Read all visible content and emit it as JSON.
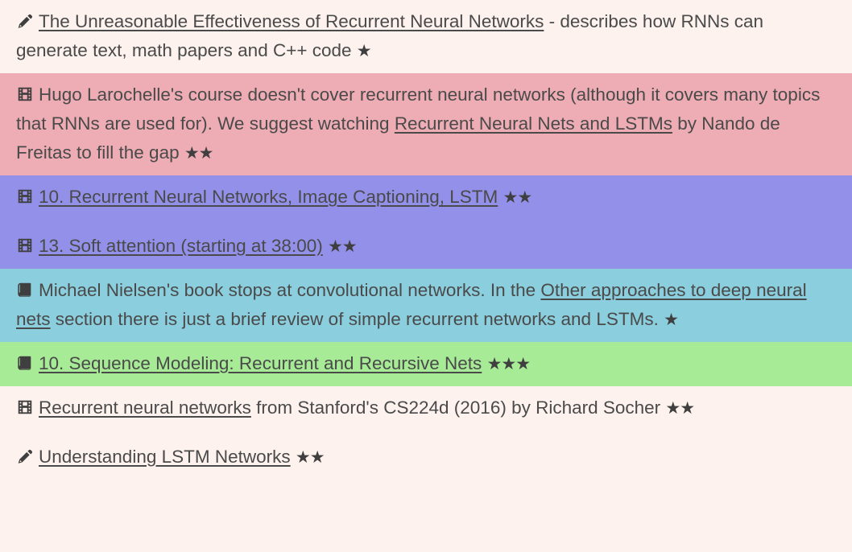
{
  "page": {
    "background_color": "#fdf2ee",
    "text_color": "#4a4a4a"
  },
  "icons": {
    "pencil": "pencil-icon",
    "film": "film-icon",
    "book": "book-icon"
  },
  "entries": [
    {
      "id": "rnn-effectiveness",
      "icon": "pencil-icon",
      "highlight": "none",
      "highlight_color": "#fdf2ee",
      "link_text": "The Unreasonable Effectiveness of Recurrent Neural Networks",
      "after_text": " - describes how RNNs can generate text, math papers and C++ code ",
      "stars": "★",
      "star_count": 1
    },
    {
      "id": "hugo-larochelle-gap",
      "icon": "film-icon",
      "highlight": "pink",
      "highlight_color": "#eeacb4",
      "before_text": "Hugo Larochelle's course doesn't cover recurrent neural networks (although it covers many topics that RNNs are used for). We suggest watching ",
      "link_text": "Recurrent Neural Nets and LSTMs",
      "after_text": " by Nando de Freitas to fill the gap ",
      "stars": "★★",
      "star_count": 2
    },
    {
      "id": "cs231n-lecture-10",
      "icon": "film-icon",
      "highlight": "purple",
      "highlight_color": "#9290e8",
      "link_text": "10. Recurrent Neural Networks, Image Captioning, LSTM",
      "after_text": " ",
      "stars": "★★",
      "star_count": 2
    },
    {
      "id": "cs231n-lecture-13",
      "icon": "film-icon",
      "highlight": "purple",
      "highlight_color": "#9290e8",
      "link_text": "13. Soft attention (starting at 38:00)",
      "after_text": " ",
      "stars": "★★",
      "star_count": 2
    },
    {
      "id": "nielsen-book",
      "icon": "book-icon",
      "highlight": "cyan",
      "highlight_color": "#8bcede",
      "before_text": "Michael Nielsen's book stops at convolutional networks. In the ",
      "link_text": "Other approaches to deep neural nets",
      "after_text": " section there is just a brief review of simple recurrent networks and LSTMs. ",
      "stars": "★",
      "star_count": 1
    },
    {
      "id": "dl-book-chapter-10",
      "icon": "book-icon",
      "highlight": "green",
      "highlight_color": "#a7eb97",
      "link_text": "10. Sequence Modeling: Recurrent and Recursive Nets",
      "after_text": " ",
      "stars": "★★★",
      "star_count": 3
    },
    {
      "id": "cs224d-socher",
      "icon": "film-icon",
      "highlight": "none",
      "highlight_color": "#fdf2ee",
      "link_text": "Recurrent neural networks",
      "after_text": " from Stanford's CS224d (2016) by Richard Socher ",
      "stars": "★★",
      "star_count": 2
    },
    {
      "id": "understanding-lstm",
      "icon": "pencil-icon",
      "highlight": "none",
      "highlight_color": "#fdf2ee",
      "link_text": "Understanding LSTM Networks",
      "after_text": " ",
      "stars": "★★",
      "star_count": 2
    }
  ]
}
